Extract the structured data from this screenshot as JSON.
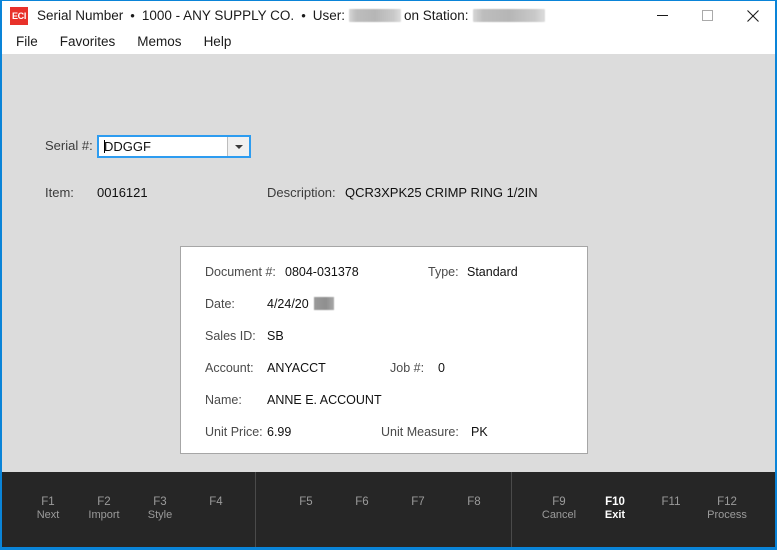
{
  "window": {
    "app_icon_text": "ECI",
    "title_parts": {
      "app_name": "Serial Number",
      "separator": "•",
      "company": "1000 - ANY SUPPLY CO.",
      "user_label": "User:",
      "station_label": "on Station:"
    },
    "controls": {
      "minimize": "minimize-icon",
      "maximize": "maximize-icon",
      "close": "close-icon"
    },
    "accent_color": "#0a84d8",
    "titlebar_bg": "#ffffff",
    "content_bg": "#dcdcdc",
    "fnbar_bg": "#262626"
  },
  "menubar": {
    "items": [
      {
        "label": "File"
      },
      {
        "label": "Favorites"
      },
      {
        "label": "Memos"
      },
      {
        "label": "Help"
      }
    ]
  },
  "form": {
    "serial": {
      "label": "Serial #:",
      "value": "DDGGF",
      "placeholder": "",
      "dropdown_icon": "chevron-down-icon",
      "focused": true
    },
    "item": {
      "label": "Item:",
      "value": "0016121"
    },
    "description": {
      "label": "Description:",
      "value": "QCR3XPK25 CRIMP RING 1/2IN"
    }
  },
  "detail_panel": {
    "document_number": {
      "label": "Document #:",
      "value": "0804-031378"
    },
    "type": {
      "label": "Type:",
      "value": "Standard"
    },
    "date": {
      "label": "Date:",
      "value": "4/24/20"
    },
    "sales_id": {
      "label": "Sales ID:",
      "value": "SB"
    },
    "account": {
      "label": "Account:",
      "value": "ANYACCT"
    },
    "job_number": {
      "label": "Job #:",
      "value": "0"
    },
    "name": {
      "label": "Name:",
      "value": "ANNE E. ACCOUNT"
    },
    "unit_price": {
      "label": "Unit Price:",
      "value": "6.99"
    },
    "unit_measure": {
      "label": "Unit Measure:",
      "value": "PK"
    }
  },
  "function_bar": {
    "groups": [
      {
        "keys": [
          {
            "key": "F1",
            "label": "Next",
            "active": false
          },
          {
            "key": "F2",
            "label": "Import",
            "active": false
          },
          {
            "key": "F3",
            "label": "Style",
            "active": false
          },
          {
            "key": "F4",
            "label": "",
            "active": false
          }
        ]
      },
      {
        "keys": [
          {
            "key": "F5",
            "label": "",
            "active": false
          },
          {
            "key": "F6",
            "label": "",
            "active": false
          },
          {
            "key": "F7",
            "label": "",
            "active": false
          },
          {
            "key": "F8",
            "label": "",
            "active": false
          }
        ]
      },
      {
        "keys": [
          {
            "key": "F9",
            "label": "Cancel",
            "active": false
          },
          {
            "key": "F10",
            "label": "Exit",
            "active": true
          },
          {
            "key": "F11",
            "label": "",
            "active": false
          },
          {
            "key": "F12",
            "label": "Process",
            "active": false
          }
        ]
      }
    ]
  }
}
